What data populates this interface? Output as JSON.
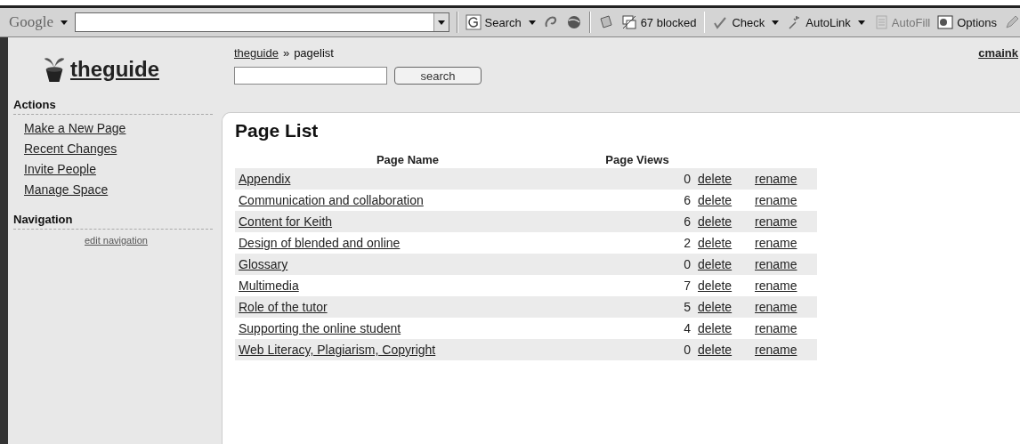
{
  "toolbar": {
    "brand": "Google",
    "search_label": "Search",
    "blocked": "67 blocked",
    "check": "Check",
    "autolink": "AutoLink",
    "autofill": {
      "label": "AutoFill",
      "disabled": true
    },
    "options": "Options"
  },
  "site": {
    "name": "theguide",
    "user": "cmaink"
  },
  "breadcrumb": {
    "home": "theguide",
    "separator": "»",
    "current": "pagelist"
  },
  "search_button": "search",
  "sidebar": [
    {
      "title": "Actions",
      "items": [
        "Make a New Page",
        "Recent Changes",
        "Invite People",
        "Manage Space"
      ]
    },
    {
      "title": "Navigation",
      "edit_link": "edit navigation"
    }
  ],
  "page_title": "Page List",
  "table": {
    "columns": [
      "Page Name",
      "Page Views"
    ],
    "rows": [
      {
        "name": "Appendix",
        "views": "0",
        "delete": "delete",
        "rename": "rename"
      },
      {
        "name": "Communication and collaboration",
        "views": "6",
        "delete": "delete",
        "rename": "rename"
      },
      {
        "name": "Content for Keith",
        "views": "6",
        "delete": "delete",
        "rename": "rename"
      },
      {
        "name": "Design of blended and online",
        "views": "2",
        "delete": "delete",
        "rename": "rename"
      },
      {
        "name": "Glossary",
        "views": "0",
        "delete": "delete",
        "rename": "rename"
      },
      {
        "name": "Multimedia",
        "views": "7",
        "delete": "delete",
        "rename": "rename"
      },
      {
        "name": "Role of the tutor",
        "views": "5",
        "delete": "delete",
        "rename": "rename"
      },
      {
        "name": "Supporting the online student",
        "views": "4",
        "delete": "delete",
        "rename": "rename"
      },
      {
        "name": "Web Literacy, Plagiarism, Copyright",
        "views": "0",
        "delete": "delete",
        "rename": "rename"
      }
    ]
  }
}
